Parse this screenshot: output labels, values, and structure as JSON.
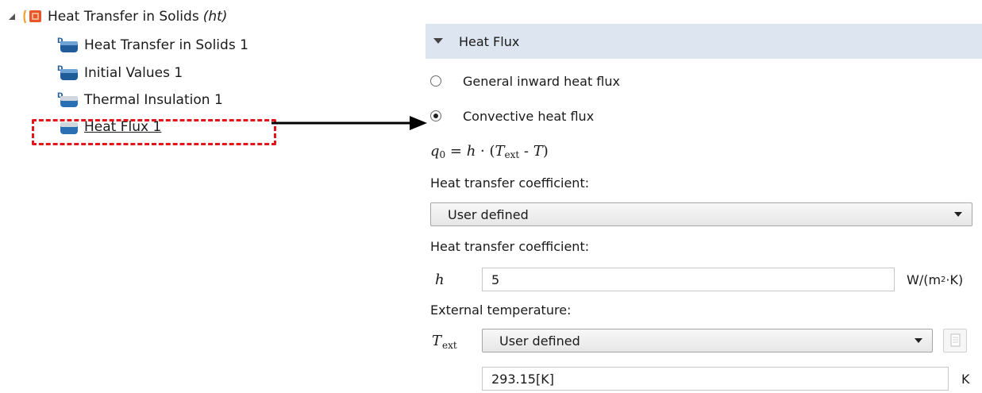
{
  "model_tree": {
    "root": {
      "label": "Heat Transfer in Solids",
      "tag": "(ht)",
      "icon": "physics-interface-icon"
    },
    "children": [
      {
        "label": "Heat Transfer in Solids 1",
        "icon": "domain-node-icon"
      },
      {
        "label": "Initial Values 1",
        "icon": "domain-node-icon"
      },
      {
        "label": "Thermal Insulation 1",
        "icon": "boundary-default-node-icon"
      },
      {
        "label": "Heat Flux 1",
        "icon": "boundary-node-icon"
      }
    ]
  },
  "settings": {
    "section_title": "Heat Flux",
    "radio_options": [
      {
        "label": "General inward heat flux",
        "checked": false
      },
      {
        "label": "Convective heat flux",
        "checked": true
      }
    ],
    "equation": {
      "lhs": "q",
      "lhs_sub": "0",
      "rhs_h": "h",
      "rhs_T": "T",
      "rhs_sub": "ext",
      "rhs_T2": "T"
    },
    "htc_label_1": "Heat transfer coefficient:",
    "htc_select": "User defined",
    "htc_label_2": "Heat transfer coefficient:",
    "h_symbol": "h",
    "h_value": "5",
    "h_unit_prefix": "W/(m",
    "h_unit_sup": "2",
    "h_unit_suffix": "·K)",
    "ext_temp_label": "External temperature:",
    "t_symbol": "T",
    "t_symbol_sub": "ext",
    "t_select": "User defined",
    "t_value": "293.15[K]",
    "t_unit": "K"
  },
  "colors": {
    "highlight": "#e3151b",
    "section_header_bg": "#dde6f0",
    "root_icon": "#e8572a",
    "node_icon": "#1f5c99"
  }
}
